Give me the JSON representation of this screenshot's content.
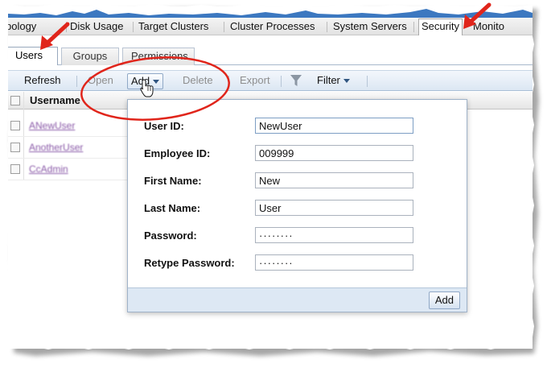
{
  "main_nav": {
    "tabs": [
      {
        "label": "pology"
      },
      {
        "label": "Disk Usage"
      },
      {
        "label": "Target Clusters"
      },
      {
        "label": "Cluster Processes"
      },
      {
        "label": "System Servers"
      },
      {
        "label": "Security",
        "active": true
      },
      {
        "label": "Monito"
      }
    ]
  },
  "sub_tabs": [
    {
      "label": "Users",
      "active": true
    },
    {
      "label": "Groups"
    },
    {
      "label": "Permissions"
    }
  ],
  "toolbar": {
    "refresh": "Refresh",
    "open": "Open",
    "add": "Add",
    "delete": "Delete",
    "export": "Export",
    "filter": "Filter"
  },
  "grid": {
    "headers": [
      "Username"
    ],
    "rows": [
      "ANewUser",
      "AnotherUser",
      "CcAdmin"
    ]
  },
  "add_user_form": {
    "fields": [
      {
        "label": "User ID:",
        "value": "NewUser"
      },
      {
        "label": "Employee ID:",
        "value": "009999"
      },
      {
        "label": "First Name:",
        "value": "New"
      },
      {
        "label": "Last Name:",
        "value": "User"
      },
      {
        "label": "Password:",
        "value": "········"
      },
      {
        "label": "Retype Password:",
        "value": "········"
      }
    ],
    "submit": "Add"
  },
  "colors": {
    "annotation_red": "#e0251b",
    "toolbar_blue": "#dce7f3",
    "link_purple": "#8a5aa8"
  }
}
